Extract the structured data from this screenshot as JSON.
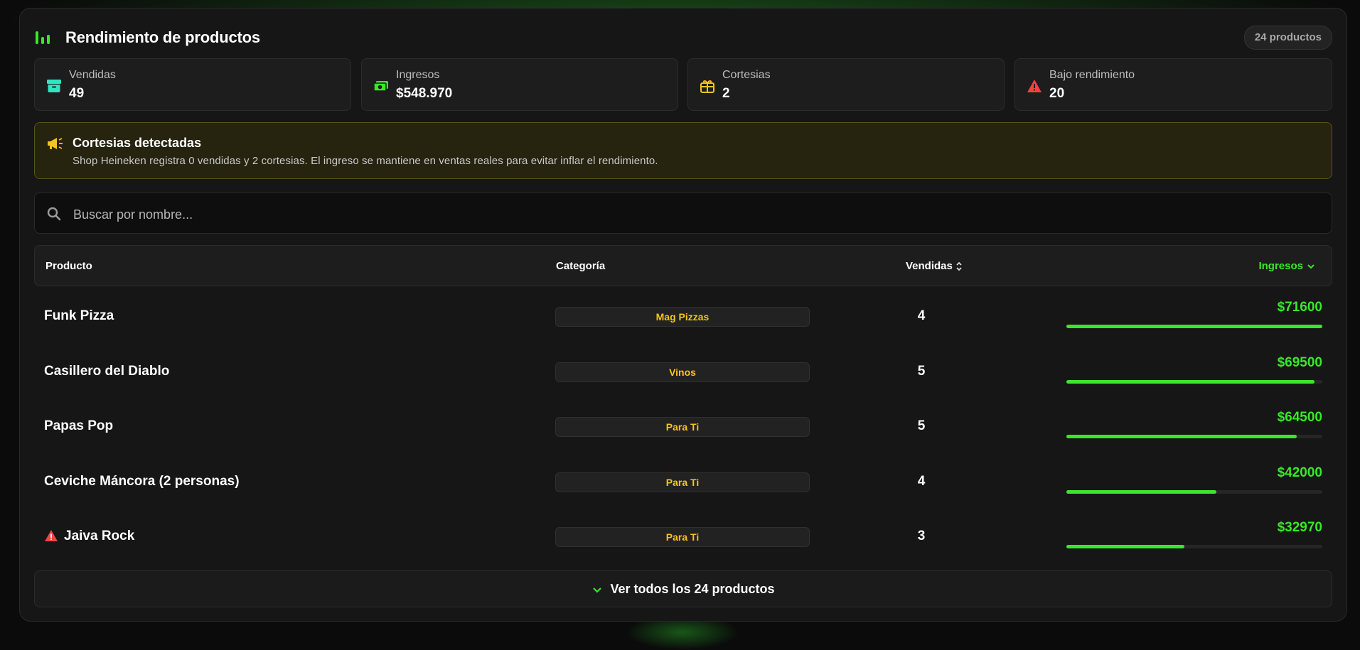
{
  "header": {
    "title": "Rendimiento de productos",
    "count_badge": "24 productos",
    "icon": "bar-chart-icon"
  },
  "stats": [
    {
      "label": "Vendidas",
      "value": "49",
      "icon": "archive-box-icon",
      "color": "#2ee6c0"
    },
    {
      "label": "Ingresos",
      "value": "$548.970",
      "icon": "cash-icon",
      "color": "#39e829"
    },
    {
      "label": "Cortesias",
      "value": "2",
      "icon": "gift-icon",
      "color": "#f5c518"
    },
    {
      "label": "Bajo rendimiento",
      "value": "20",
      "icon": "warning-icon",
      "color": "#ef4444"
    }
  ],
  "alert": {
    "title": "Cortesias detectadas",
    "text": "Shop Heineken registra 0 vendidas y 2 cortesias. El ingreso se mantiene en ventas reales para evitar inflar el rendimiento.",
    "icon": "megaphone-icon",
    "color": "#f5c518"
  },
  "search": {
    "placeholder": "Buscar por nombre...",
    "value": ""
  },
  "table": {
    "headers": {
      "product": "Producto",
      "category": "Categoría",
      "sold": "Vendidas",
      "income": "Ingresos"
    },
    "rows": [
      {
        "name": "Funk Pizza",
        "category": "Mag Pizzas",
        "sold": "4",
        "income": "$71600",
        "income_value": 71600,
        "low": false
      },
      {
        "name": "Casillero del Diablo",
        "category": "Vinos",
        "sold": "5",
        "income": "$69500",
        "income_value": 69500,
        "low": false
      },
      {
        "name": "Papas Pop",
        "category": "Para Ti",
        "sold": "5",
        "income": "$64500",
        "income_value": 64500,
        "low": false
      },
      {
        "name": "Ceviche Máncora (2 personas)",
        "category": "Para Ti",
        "sold": "4",
        "income": "$42000",
        "income_value": 42000,
        "low": false
      },
      {
        "name": "Jaiva Rock",
        "category": "Para Ti",
        "sold": "3",
        "income": "$32970",
        "income_value": 32970,
        "low": true
      }
    ]
  },
  "footer": {
    "view_all_label": "Ver todos los 24 productos"
  },
  "colors": {
    "accent": "#39e829",
    "category": "#f5c518",
    "danger": "#ef4444"
  }
}
